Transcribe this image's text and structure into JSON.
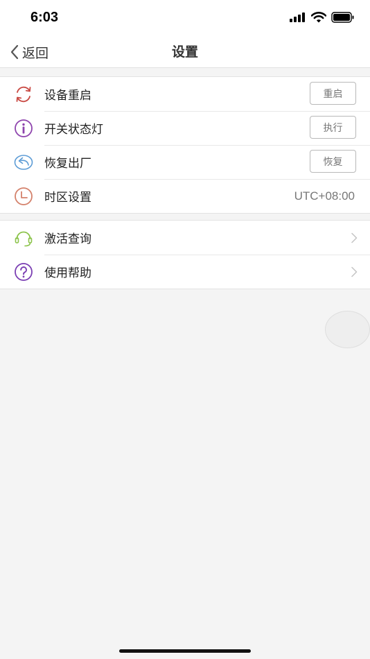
{
  "status_bar": {
    "time": "6:03"
  },
  "nav": {
    "back_label": "返回",
    "title": "设置"
  },
  "group1": [
    {
      "name": "device-restart",
      "label": "设备重启",
      "icon": "refresh-icon",
      "action": "重启"
    },
    {
      "name": "status-light",
      "label": "开关状态灯",
      "icon": "info-icon",
      "action": "执行"
    },
    {
      "name": "factory-reset",
      "label": "恢复出厂",
      "icon": "undo-icon",
      "action": "恢复"
    },
    {
      "name": "timezone",
      "label": "时区设置",
      "icon": "clock-icon",
      "value": "UTC+08:00"
    }
  ],
  "group2": [
    {
      "name": "activation-query",
      "label": "激活查询",
      "icon": "headset-icon"
    },
    {
      "name": "help",
      "label": "使用帮助",
      "icon": "question-icon"
    }
  ],
  "colors": {
    "restart_icon": "#c94a44",
    "info_icon": "#8e44ad",
    "undo_icon": "#5b9bd5",
    "clock_icon": "#d4816b",
    "headset_icon": "#8bc34a",
    "question_icon": "#7b3fb3"
  }
}
